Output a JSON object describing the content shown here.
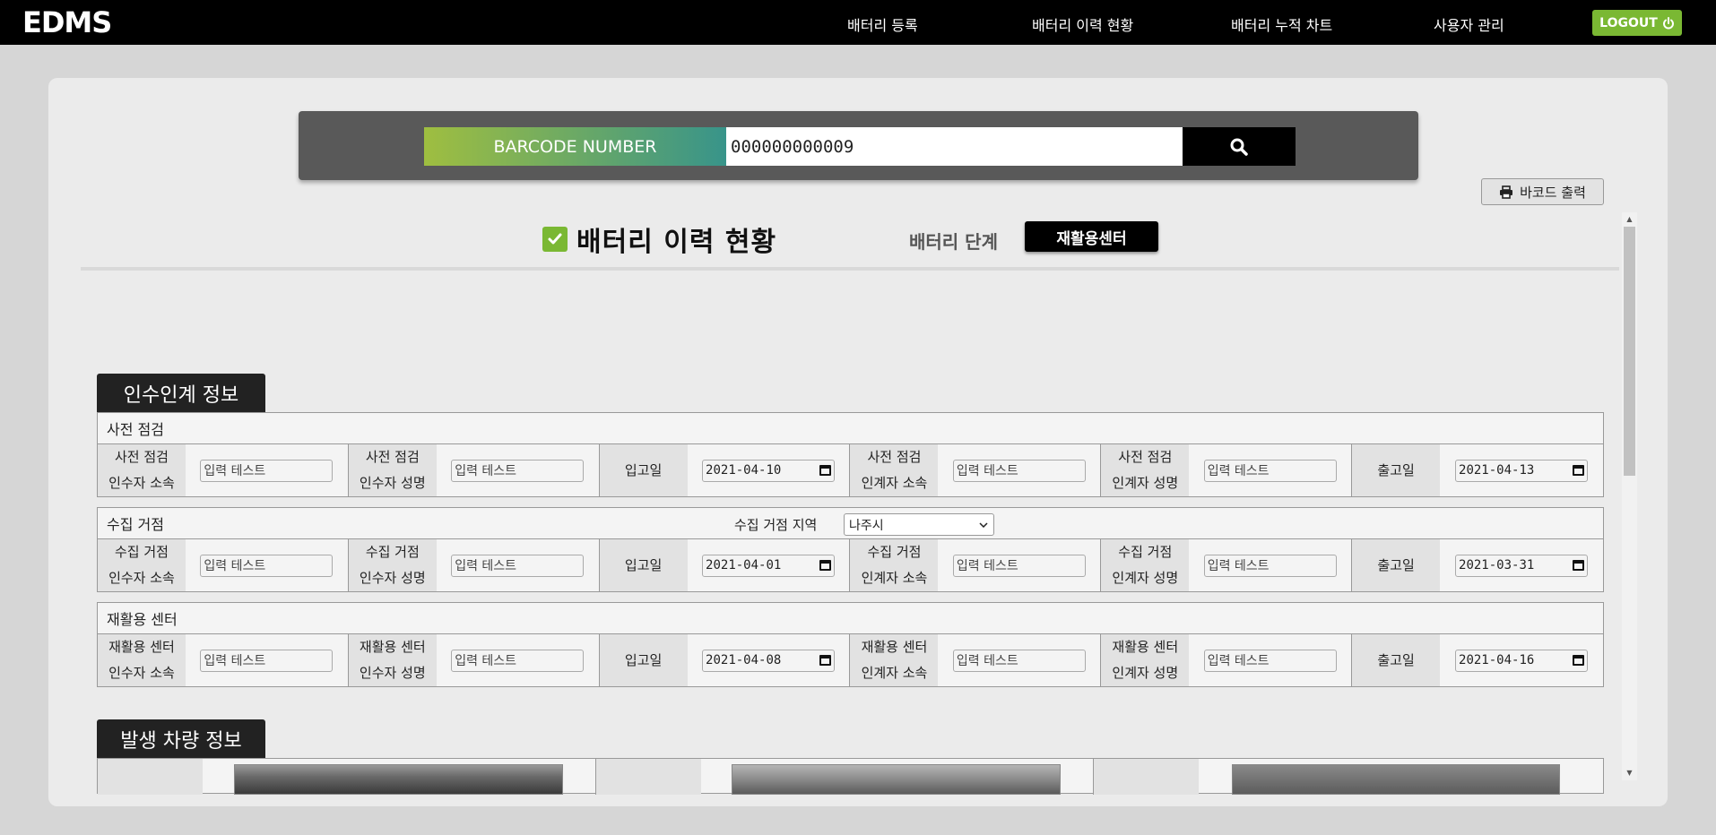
{
  "app": {
    "logo": "EDMS",
    "nav": [
      "배터리 등록",
      "배터리 이력 현황",
      "배터리 누적 차트",
      "사용자 관리"
    ],
    "logout_label": "LOGOUT"
  },
  "search": {
    "label": "BARCODE NUMBER",
    "value": "000000000009"
  },
  "print_button_label": "바코드 출력",
  "page_title": "배터리 이력 현황",
  "stage": {
    "label": "배터리 단계",
    "value": "재활용센터"
  },
  "handover": {
    "section_title": "인수인계 정보",
    "blocks": [
      {
        "title": "사전 점검",
        "fields": [
          {
            "label1": "사전 점검",
            "label2": "인수자 소속",
            "type": "text",
            "placeholder": "입력 테스트"
          },
          {
            "label1": "사전 점검",
            "label2": "인수자 성명",
            "type": "text",
            "placeholder": "입력 테스트"
          },
          {
            "label1": "입고일",
            "label2": "",
            "type": "date",
            "value": "2021-04-10"
          },
          {
            "label1": "사전 점검",
            "label2": "인계자 소속",
            "type": "text",
            "placeholder": "입력 테스트"
          },
          {
            "label1": "사전 점검",
            "label2": "인계자 성명",
            "type": "text",
            "placeholder": "입력 테스트"
          },
          {
            "label1": "출고일",
            "label2": "",
            "type": "date",
            "value": "2021-04-13"
          }
        ]
      },
      {
        "title": "수집 거점",
        "region_label": "수집 거점 지역",
        "region_value": "나주시",
        "fields": [
          {
            "label1": "수집 거점",
            "label2": "인수자 소속",
            "type": "text",
            "placeholder": "입력 테스트"
          },
          {
            "label1": "수집 거점",
            "label2": "인수자 성명",
            "type": "text",
            "placeholder": "입력 테스트"
          },
          {
            "label1": "입고일",
            "label2": "",
            "type": "date",
            "value": "2021-04-01"
          },
          {
            "label1": "수집 거점",
            "label2": "인계자 소속",
            "type": "text",
            "placeholder": "입력 테스트"
          },
          {
            "label1": "수집 거점",
            "label2": "인계자 성명",
            "type": "text",
            "placeholder": "입력 테스트"
          },
          {
            "label1": "출고일",
            "label2": "",
            "type": "date",
            "value": "2021-03-31"
          }
        ]
      },
      {
        "title": "재활용 센터",
        "fields": [
          {
            "label1": "재활용 센터",
            "label2": "인수자 소속",
            "type": "text",
            "placeholder": "입력 테스트"
          },
          {
            "label1": "재활용 센터",
            "label2": "인수자 성명",
            "type": "text",
            "placeholder": "입력 테스트"
          },
          {
            "label1": "입고일",
            "label2": "",
            "type": "date",
            "value": "2021-04-08"
          },
          {
            "label1": "재활용 센터",
            "label2": "인계자 소속",
            "type": "text",
            "placeholder": "입력 테스트"
          },
          {
            "label1": "재활용 센터",
            "label2": "인계자 성명",
            "type": "text",
            "placeholder": "입력 테스트"
          },
          {
            "label1": "출고일",
            "label2": "",
            "type": "date",
            "value": "2021-04-16"
          }
        ]
      }
    ]
  },
  "vehicle": {
    "section_title": "발생 차량 정보"
  },
  "colors": {
    "nav_bg": "#000000",
    "accent_green": "#7ab833",
    "gradient_start": "#9fbe40",
    "gradient_end": "#38948a"
  }
}
